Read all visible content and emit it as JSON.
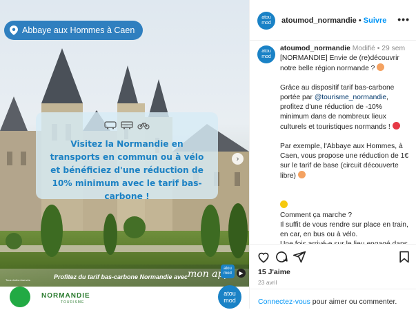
{
  "media": {
    "location": "Abbaye aux Hommes à Caen",
    "card_text": "Visitez la Normandie en transports en commun ou à vélo et bénéficiez d'une réduction de 10% minimum avec le tarif bas-carbone !",
    "transport_icons": [
      "train-icon",
      "bus-icon",
      "bike-icon"
    ],
    "banner_text": "Profitez du tarif bas-carbone Normandie avec",
    "banner_mon": "mon app",
    "app_logo": "atou mod",
    "normandie_logo": "NORMANDIE",
    "normandie_sub": "TOURISME",
    "caption": "Tous droits réservés"
  },
  "post": {
    "username": "atoumod_normandie",
    "separator": "•",
    "follow": "Suivre",
    "more": "•••",
    "avatar_text": "atou mod",
    "modified": "Modifié",
    "time": "29 sem",
    "paragraphs": [
      {
        "text": "[NORMANDIE] Envie de (re)découvrir notre belle région normande ?"
      },
      {
        "before": "Grâce au dispositif tarif bas-carbone portée par ",
        "mention": "@tourisme_normandie",
        "after": ", profitez d'une réduction de -10% minimum dans de nombreux lieux culturels et touristiques normands !"
      },
      {
        "text": "Par exemple, l'Abbaye aux Hommes, à Caen, vous propose une réduction de 1€ sur le tarif de base (circuit découverte libre)"
      },
      {
        "text": "Comment ça marche ?\nIl suffit de vous rendre sur place en train, en car, en bus ou à vélo.\nUne fois arrivé-e sur le lieu engagé dans cette démarche, présentez simplement votre titre de transport ou une photo de vous devant le site avec votre vélo !"
      }
    ],
    "likes": "15 J'aime",
    "date": "23 avril",
    "login_link": "Connectez-vous",
    "login_rest": " pour aimer ou commenter."
  },
  "colors": {
    "accent": "#0095f6",
    "brand": "#1a82c6",
    "card_text": "#1d82c4"
  }
}
